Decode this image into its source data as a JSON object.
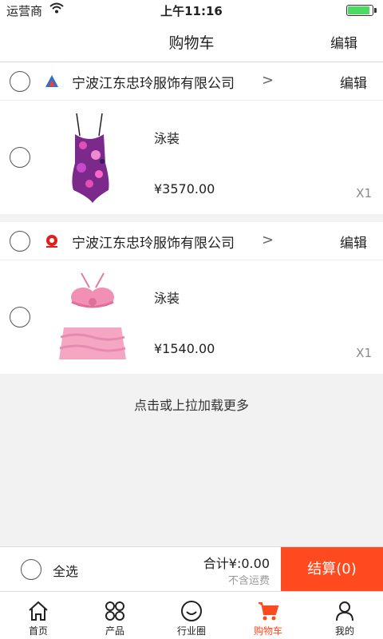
{
  "status_bar": {
    "carrier": "运营商",
    "time": "上午11:16"
  },
  "header": {
    "title": "购物车",
    "edit_label": "编辑"
  },
  "stores": [
    {
      "name": "宁波江东忠玲服饰有限公司",
      "edit_label": "编辑",
      "item": {
        "name": "泳装",
        "price": "¥3570.00",
        "quantity": "X1"
      }
    },
    {
      "name": "宁波江东忠玲服饰有限公司",
      "edit_label": "编辑",
      "item": {
        "name": "泳装",
        "price": "¥1540.00",
        "quantity": "X1"
      }
    }
  ],
  "load_more": "点击或上拉加载更多",
  "checkout": {
    "select_all": "全选",
    "total": "合计¥:0.00",
    "shipping_note": "不含运费",
    "pay_button": "结算(0)"
  },
  "tabbar": {
    "items": [
      {
        "label": "首页",
        "icon": "home-icon"
      },
      {
        "label": "产品",
        "icon": "grid-icon"
      },
      {
        "label": "行业圈",
        "icon": "smile-icon"
      },
      {
        "label": "购物车",
        "icon": "cart-icon"
      },
      {
        "label": "我的",
        "icon": "user-icon"
      }
    ],
    "active_index": 3
  },
  "colors": {
    "accent": "#ff4a1f",
    "background": "#f2f2f2"
  }
}
